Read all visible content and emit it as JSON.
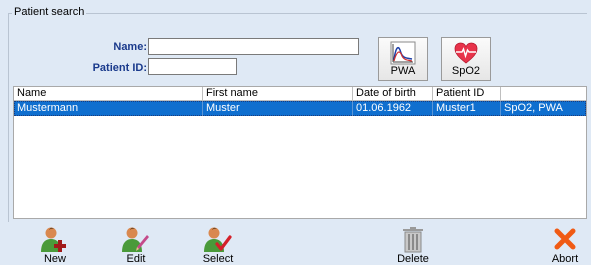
{
  "search": {
    "group_title": "Patient search",
    "name_label": "Name:",
    "name_value": "",
    "patient_id_label": "Patient ID:",
    "patient_id_value": "",
    "pwa_label": "PWA",
    "spo2_label": "SpO2"
  },
  "table": {
    "columns": [
      "Name",
      "First name",
      "Date of birth",
      "Patient ID",
      ""
    ],
    "rows": [
      {
        "name": "Mustermann",
        "first_name": "Muster",
        "date_of_birth": "01.06.1962",
        "patient_id": "Muster1",
        "measurements": "SpO2, PWA",
        "selected": true
      }
    ]
  },
  "toolbar": {
    "new_label": "New",
    "edit_label": "Edit",
    "select_label": "Select",
    "delete_label": "Delete",
    "abort_label": "Abort"
  },
  "colors": {
    "background": "#dfe9f5",
    "selection": "#0f6fcf",
    "label_blue": "#1a3a8c",
    "person_green": "#4a9a3a",
    "person_skin": "#d9884f",
    "abort_orange": "#f05a14",
    "heart_red": "#e8334a"
  },
  "icons": {
    "pwa": "pulse-wave-icon",
    "spo2": "heart-icon",
    "new": "add-patient-icon",
    "edit": "edit-patient-icon",
    "select": "select-patient-icon",
    "delete": "trash-icon",
    "abort": "abort-x-icon"
  }
}
